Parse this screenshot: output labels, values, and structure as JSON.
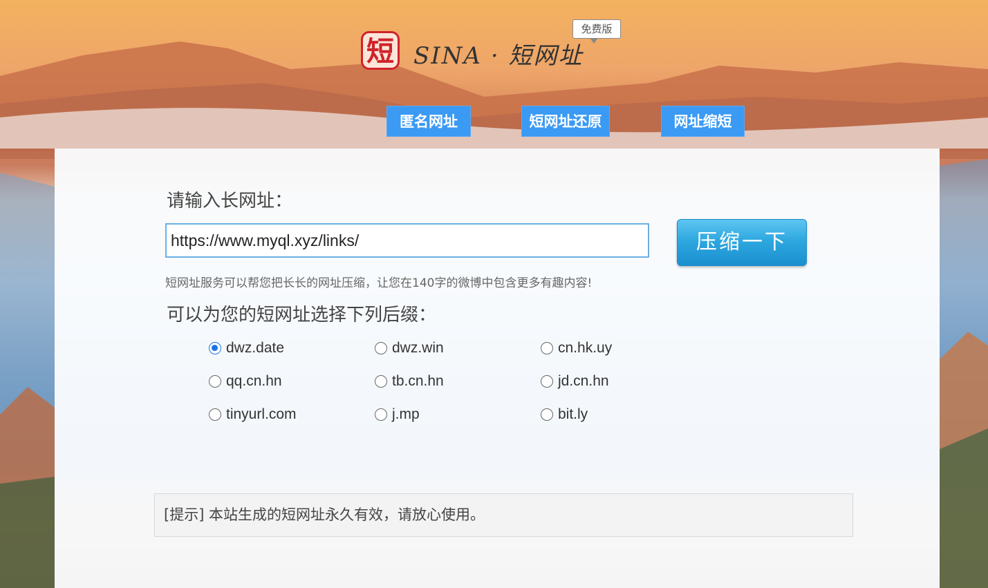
{
  "logo": {
    "seal_char": "短",
    "title": "SINA · 短网址",
    "badge": "免费版"
  },
  "nav": [
    {
      "label": "匿名网址"
    },
    {
      "label": "短网址还原"
    },
    {
      "label": "网址缩短"
    }
  ],
  "form": {
    "input_label": "请输入长网址：",
    "url_value": "https://www.myql.xyz/links/",
    "submit_label": "压缩一下",
    "help_text": "短网址服务可以帮您把长长的网址压缩，让您在140字的微博中包含更多有趣内容!",
    "suffix_label": "可以为您的短网址选择下列后缀：",
    "suffixes": [
      {
        "label": "dwz.date",
        "checked": true
      },
      {
        "label": "dwz.win",
        "checked": false
      },
      {
        "label": "cn.hk.uy",
        "checked": false
      },
      {
        "label": "qq.cn.hn",
        "checked": false
      },
      {
        "label": "tb.cn.hn",
        "checked": false
      },
      {
        "label": "jd.cn.hn",
        "checked": false
      },
      {
        "label": "tinyurl.com",
        "checked": false
      },
      {
        "label": "j.mp",
        "checked": false
      },
      {
        "label": "bit.ly",
        "checked": false
      }
    ]
  },
  "notice": "[提示] 本站生成的短网址永久有效，请放心使用。",
  "colors": {
    "nav_button": "#3b9af4",
    "submit_button": "#2ea8e0",
    "radio_checked": "#1a73e8",
    "seal": "#d0232a"
  }
}
